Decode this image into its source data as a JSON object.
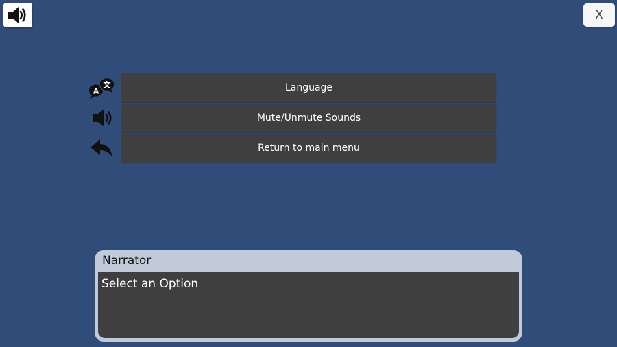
{
  "top_bar": {
    "sound_icon": "speaker-icon",
    "close_label": "X"
  },
  "menu": {
    "items": [
      {
        "label": "Language",
        "icon": "language-icon"
      },
      {
        "label": "Mute/Unmute Sounds",
        "icon": "speaker-icon"
      },
      {
        "label": "Return to main menu",
        "icon": "back-arrow-icon"
      }
    ]
  },
  "dialog": {
    "speaker": "Narrator",
    "text": "Select an Option"
  },
  "colors": {
    "background": "#304c79",
    "button": "#3f3f3f",
    "dialog_frame": "#c0cad8"
  }
}
